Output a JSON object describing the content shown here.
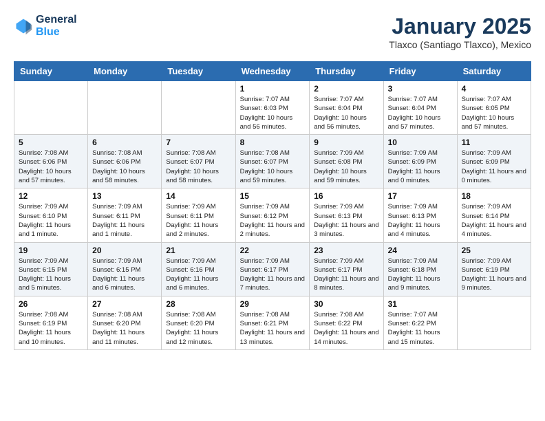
{
  "header": {
    "logo": {
      "line1": "General",
      "line2": "Blue"
    },
    "title": "January 2025",
    "location": "Tlaxco (Santiago Tlaxco), Mexico"
  },
  "weekdays": [
    "Sunday",
    "Monday",
    "Tuesday",
    "Wednesday",
    "Thursday",
    "Friday",
    "Saturday"
  ],
  "weeks": [
    [
      {
        "day": "",
        "info": ""
      },
      {
        "day": "",
        "info": ""
      },
      {
        "day": "",
        "info": ""
      },
      {
        "day": "1",
        "info": "Sunrise: 7:07 AM\nSunset: 6:03 PM\nDaylight: 10 hours and 56 minutes."
      },
      {
        "day": "2",
        "info": "Sunrise: 7:07 AM\nSunset: 6:04 PM\nDaylight: 10 hours and 56 minutes."
      },
      {
        "day": "3",
        "info": "Sunrise: 7:07 AM\nSunset: 6:04 PM\nDaylight: 10 hours and 57 minutes."
      },
      {
        "day": "4",
        "info": "Sunrise: 7:07 AM\nSunset: 6:05 PM\nDaylight: 10 hours and 57 minutes."
      }
    ],
    [
      {
        "day": "5",
        "info": "Sunrise: 7:08 AM\nSunset: 6:06 PM\nDaylight: 10 hours and 57 minutes."
      },
      {
        "day": "6",
        "info": "Sunrise: 7:08 AM\nSunset: 6:06 PM\nDaylight: 10 hours and 58 minutes."
      },
      {
        "day": "7",
        "info": "Sunrise: 7:08 AM\nSunset: 6:07 PM\nDaylight: 10 hours and 58 minutes."
      },
      {
        "day": "8",
        "info": "Sunrise: 7:08 AM\nSunset: 6:07 PM\nDaylight: 10 hours and 59 minutes."
      },
      {
        "day": "9",
        "info": "Sunrise: 7:09 AM\nSunset: 6:08 PM\nDaylight: 10 hours and 59 minutes."
      },
      {
        "day": "10",
        "info": "Sunrise: 7:09 AM\nSunset: 6:09 PM\nDaylight: 11 hours and 0 minutes."
      },
      {
        "day": "11",
        "info": "Sunrise: 7:09 AM\nSunset: 6:09 PM\nDaylight: 11 hours and 0 minutes."
      }
    ],
    [
      {
        "day": "12",
        "info": "Sunrise: 7:09 AM\nSunset: 6:10 PM\nDaylight: 11 hours and 1 minute."
      },
      {
        "day": "13",
        "info": "Sunrise: 7:09 AM\nSunset: 6:11 PM\nDaylight: 11 hours and 1 minute."
      },
      {
        "day": "14",
        "info": "Sunrise: 7:09 AM\nSunset: 6:11 PM\nDaylight: 11 hours and 2 minutes."
      },
      {
        "day": "15",
        "info": "Sunrise: 7:09 AM\nSunset: 6:12 PM\nDaylight: 11 hours and 2 minutes."
      },
      {
        "day": "16",
        "info": "Sunrise: 7:09 AM\nSunset: 6:13 PM\nDaylight: 11 hours and 3 minutes."
      },
      {
        "day": "17",
        "info": "Sunrise: 7:09 AM\nSunset: 6:13 PM\nDaylight: 11 hours and 4 minutes."
      },
      {
        "day": "18",
        "info": "Sunrise: 7:09 AM\nSunset: 6:14 PM\nDaylight: 11 hours and 4 minutes."
      }
    ],
    [
      {
        "day": "19",
        "info": "Sunrise: 7:09 AM\nSunset: 6:15 PM\nDaylight: 11 hours and 5 minutes."
      },
      {
        "day": "20",
        "info": "Sunrise: 7:09 AM\nSunset: 6:15 PM\nDaylight: 11 hours and 6 minutes."
      },
      {
        "day": "21",
        "info": "Sunrise: 7:09 AM\nSunset: 6:16 PM\nDaylight: 11 hours and 6 minutes."
      },
      {
        "day": "22",
        "info": "Sunrise: 7:09 AM\nSunset: 6:17 PM\nDaylight: 11 hours and 7 minutes."
      },
      {
        "day": "23",
        "info": "Sunrise: 7:09 AM\nSunset: 6:17 PM\nDaylight: 11 hours and 8 minutes."
      },
      {
        "day": "24",
        "info": "Sunrise: 7:09 AM\nSunset: 6:18 PM\nDaylight: 11 hours and 9 minutes."
      },
      {
        "day": "25",
        "info": "Sunrise: 7:09 AM\nSunset: 6:19 PM\nDaylight: 11 hours and 9 minutes."
      }
    ],
    [
      {
        "day": "26",
        "info": "Sunrise: 7:08 AM\nSunset: 6:19 PM\nDaylight: 11 hours and 10 minutes."
      },
      {
        "day": "27",
        "info": "Sunrise: 7:08 AM\nSunset: 6:20 PM\nDaylight: 11 hours and 11 minutes."
      },
      {
        "day": "28",
        "info": "Sunrise: 7:08 AM\nSunset: 6:20 PM\nDaylight: 11 hours and 12 minutes."
      },
      {
        "day": "29",
        "info": "Sunrise: 7:08 AM\nSunset: 6:21 PM\nDaylight: 11 hours and 13 minutes."
      },
      {
        "day": "30",
        "info": "Sunrise: 7:08 AM\nSunset: 6:22 PM\nDaylight: 11 hours and 14 minutes."
      },
      {
        "day": "31",
        "info": "Sunrise: 7:07 AM\nSunset: 6:22 PM\nDaylight: 11 hours and 15 minutes."
      },
      {
        "day": "",
        "info": ""
      }
    ]
  ]
}
